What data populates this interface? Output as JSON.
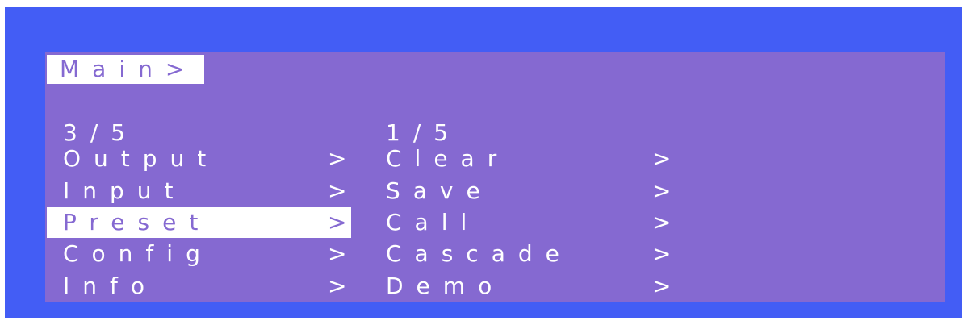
{
  "colors": {
    "frame": "#435df5",
    "screen": "#8569d1",
    "highlight": "#ffffff"
  },
  "breadcrumb": "Main>",
  "left_menu": {
    "position": "3/5",
    "selected_index": 2,
    "items": [
      {
        "label": "Output",
        "arrow": ">"
      },
      {
        "label": "Input",
        "arrow": ">"
      },
      {
        "label": "Preset",
        "arrow": ">"
      },
      {
        "label": "Config",
        "arrow": ">"
      },
      {
        "label": "Info",
        "arrow": ">"
      }
    ]
  },
  "right_menu": {
    "position": "1/5",
    "items": [
      {
        "label": "Clear",
        "arrow": ">"
      },
      {
        "label": "Save",
        "arrow": ">"
      },
      {
        "label": "Call",
        "arrow": ">"
      },
      {
        "label": "Cascade",
        "arrow": ">"
      },
      {
        "label": "Demo",
        "arrow": ">"
      }
    ]
  }
}
